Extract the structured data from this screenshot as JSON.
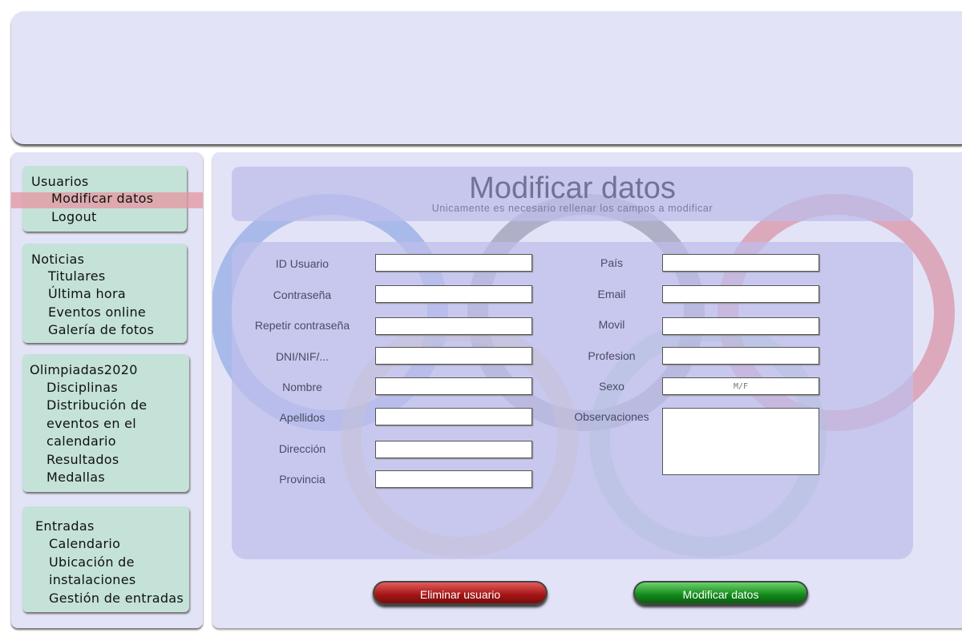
{
  "sidebar": {
    "usuarios": {
      "title": "Usuarios",
      "items": [
        "Modificar datos",
        "Logout"
      ]
    },
    "noticias": {
      "title": "Noticias",
      "items": [
        "Titulares",
        "Última hora",
        "Eventos online",
        "Galería de fotos"
      ]
    },
    "olimpiadas": {
      "title": "Olimpiadas2020",
      "items": [
        "Disciplinas",
        "Distribución de",
        "eventos en el",
        "calendario",
        "Resultados",
        "Medallas"
      ]
    },
    "entradas": {
      "title": "Entradas",
      "items": [
        "Calendario",
        "Ubicación de",
        "instalaciones",
        "Gestión de entradas"
      ]
    }
  },
  "page": {
    "title": "Modificar datos",
    "subtitle": "Unicamente es necesario rellenar los campos a modificar"
  },
  "form": {
    "left_labels": [
      "ID Usuario",
      "Contraseña",
      "Repetir contraseña",
      "DNI/NIF/...",
      "Nombre",
      "Apellidos",
      "Dirección",
      "Provincia"
    ],
    "right_labels": [
      "País",
      "Email",
      "Movil",
      "Profesion",
      "Sexo",
      "Observaciones"
    ],
    "sexo_placeholder": "M/F"
  },
  "buttons": {
    "delete": "Eliminar usuario",
    "modify": "Modificar datos"
  },
  "colors": {
    "nav_bg": "#c4e2d7",
    "panel_bg": "#e3e3f7",
    "highlight": "#e696a0",
    "delete_button": "#a31414",
    "modify_button": "#13891a"
  }
}
